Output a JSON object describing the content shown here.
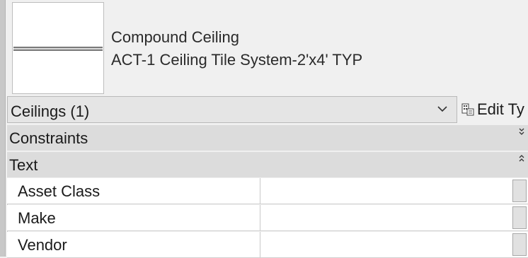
{
  "type_selector": {
    "family_name": "Compound Ceiling",
    "type_name": "ACT-1 Ceiling Tile System-2'x4' TYP"
  },
  "instance_filter": {
    "selected": "Ceilings (1)"
  },
  "edit_type": {
    "label": "Edit Ty"
  },
  "groups": {
    "constraints": "Constraints",
    "text": "Text"
  },
  "properties": [
    {
      "name": "Asset Class",
      "value": ""
    },
    {
      "name": "Make",
      "value": ""
    },
    {
      "name": "Vendor",
      "value": ""
    }
  ]
}
